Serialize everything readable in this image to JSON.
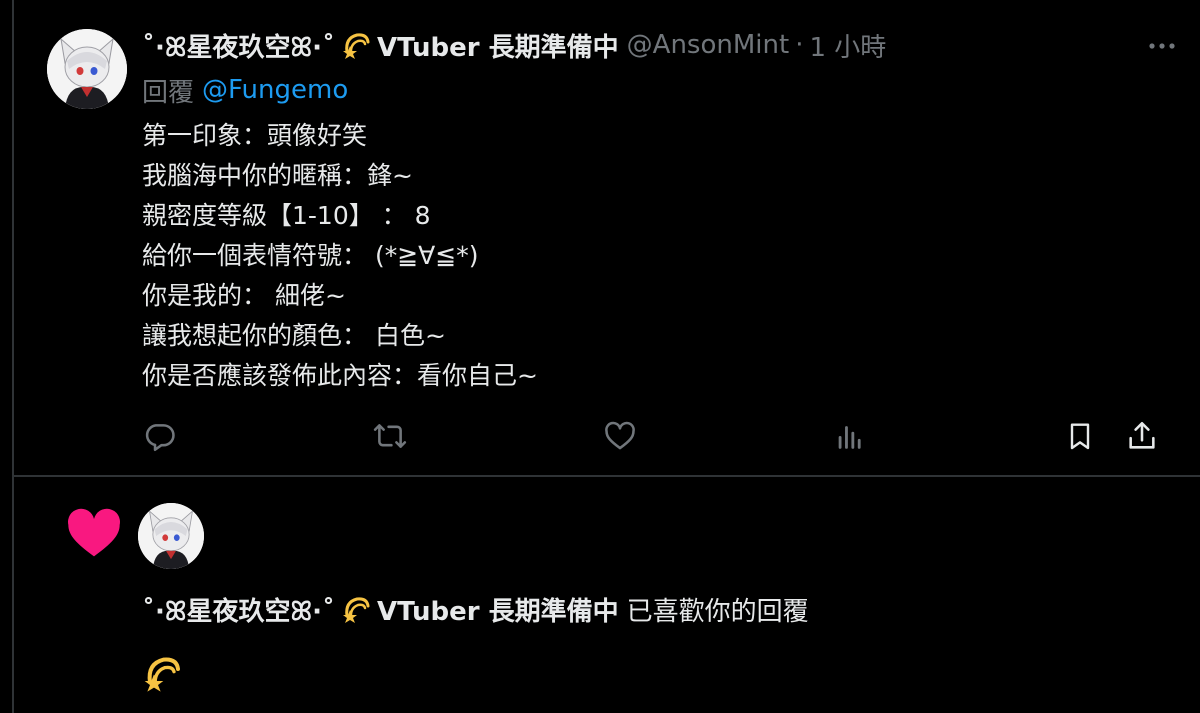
{
  "tweet": {
    "display_name": "˚·ꕤ星夜玖空ꕤ·˚",
    "name_suffix": "VTuber 長期準備中",
    "handle": "@AnsonMint",
    "separator": "·",
    "time": "1 小時",
    "reply_prefix": "回覆",
    "reply_target": "@Fungemo",
    "lines": [
      "第一印象：頭像好笑",
      "我腦海中你的暱稱：鋒~",
      "親密度等級【1-10】 ： 8",
      "給你一個表情符號：  (*≧∀≦*)",
      "你是我的： 細佬~",
      "讓我想起你的顏色： 白色~",
      "你是否應該發佈此內容：看你自己~"
    ],
    "actions": [
      "reply-icon",
      "retweet-icon",
      "like-icon",
      "views-icon",
      "bookmark-icon",
      "share-icon"
    ],
    "colors": {
      "background": "#000000",
      "text": "#e7e9ea",
      "muted": "#71767b",
      "link": "#1d9bf0",
      "divider": "#2f3336"
    }
  },
  "notification": {
    "display_name": "˚·ꕤ星夜玖空ꕤ·˚",
    "name_suffix": "VTuber 長期準備中",
    "action_text": "已喜歡你的回覆",
    "icon": "heart-icon",
    "heart_color": "#f91880"
  }
}
